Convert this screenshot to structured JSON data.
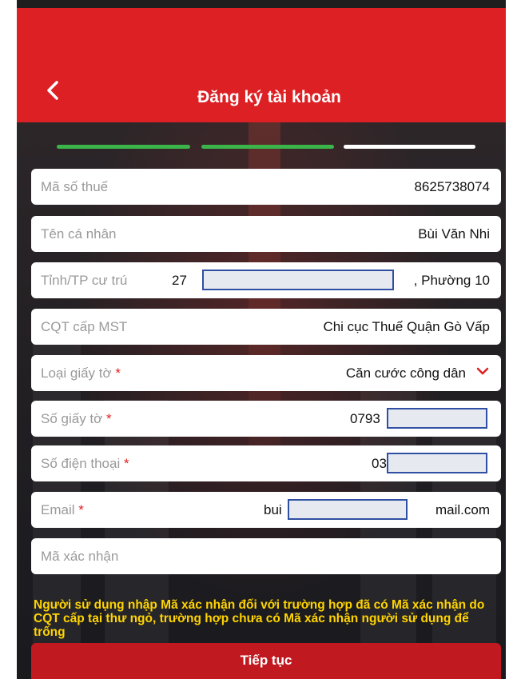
{
  "header": {
    "back_icon": "chevron-left-icon",
    "title": "Đăng ký tài khoản"
  },
  "progress": {
    "steps_total": 3,
    "steps_done": 2,
    "done_color": "#3bb54a",
    "pending_color": "#ffffff"
  },
  "form": {
    "tax_code": {
      "label": "Mã số thuế",
      "value": "8625738074"
    },
    "personal_name": {
      "label": "Tên cá nhân",
      "value": "Bùi Văn Nhi"
    },
    "residence": {
      "label": "Tỉnh/TP cư trú",
      "value_prefix": "27",
      "value_suffix": ", Phường 10"
    },
    "tax_office": {
      "label": "CQT cấp MST",
      "value": "Chi cục Thuế Quận Gò Vấp"
    },
    "document_type": {
      "label": "Loại giấy tờ",
      "required_mark": "*",
      "value": "Căn cước công dân",
      "dropdown_icon": "chevron-down-icon"
    },
    "document_number": {
      "label": "Số giấy tờ",
      "required_mark": "*",
      "value_prefix": "0793"
    },
    "phone": {
      "label": "Số điện thoại",
      "required_mark": "*",
      "value_prefix": "03"
    },
    "email": {
      "label": "Email",
      "required_mark": "*",
      "value_prefix": "bui",
      "value_suffix": "mail.com"
    },
    "verification_code": {
      "label": "Mã xác nhận",
      "value": ""
    }
  },
  "note": "Người sử dụng nhập Mã xác nhận đối với trường hợp đã có Mã xác nhận do CQT cấp tại thư ngỏ, trường hợp chưa có Mã xác nhận người sử dụng để trống",
  "submit_label": "Tiếp tục",
  "colors": {
    "header_red": "#dd2024",
    "button_red": "#c0191f",
    "note_yellow": "#ffd400",
    "required_red": "#e02020"
  }
}
